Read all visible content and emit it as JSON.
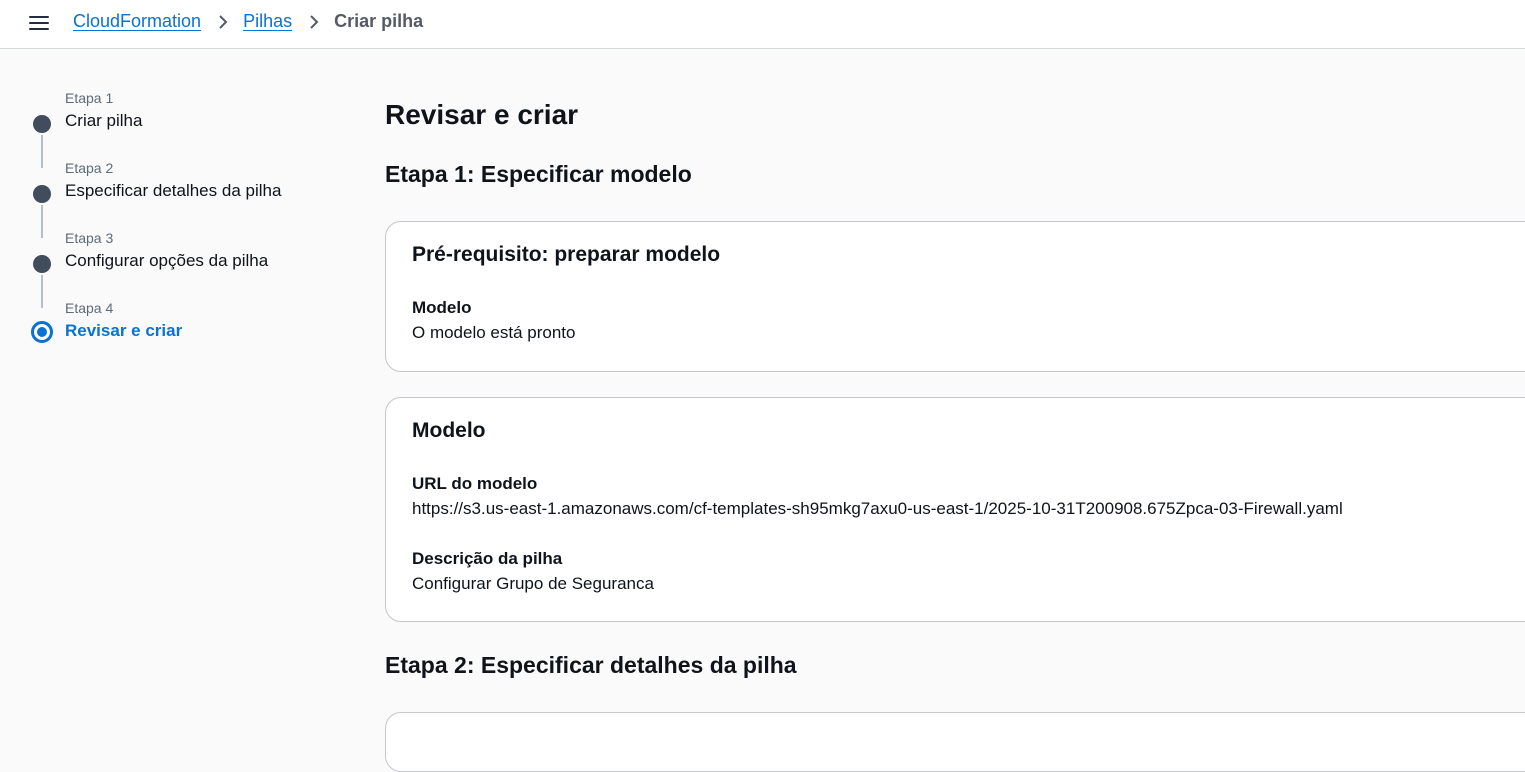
{
  "breadcrumb": {
    "items": [
      "CloudFormation",
      "Pilhas"
    ],
    "current": "Criar pilha"
  },
  "wizard": {
    "steps": [
      {
        "label": "Etapa 1",
        "title": "Criar pilha"
      },
      {
        "label": "Etapa 2",
        "title": "Especificar detalhes da pilha"
      },
      {
        "label": "Etapa 3",
        "title": "Configurar opções da pilha"
      },
      {
        "label": "Etapa 4",
        "title": "Revisar e criar"
      }
    ]
  },
  "main": {
    "title": "Revisar e criar",
    "section1": "Etapa 1: Especificar modelo",
    "prereq_card": {
      "title": "Pré-requisito: preparar modelo",
      "key": "Modelo",
      "value": "O modelo está pronto"
    },
    "model_card": {
      "title": "Modelo",
      "url_key": "URL do modelo",
      "url_value": "https://s3.us-east-1.amazonaws.com/cf-templates-sh95mkg7axu0-us-east-1/2025-10-31T200908.675Zpca-03-Firewall.yaml",
      "desc_key": "Descrição da pilha",
      "desc_value": "Configurar Grupo de Seguranca"
    },
    "section2": "Etapa 2: Especificar detalhes da pilha"
  },
  "colors": {
    "accent": "#0972d3",
    "step_dot": "#414d5c"
  }
}
